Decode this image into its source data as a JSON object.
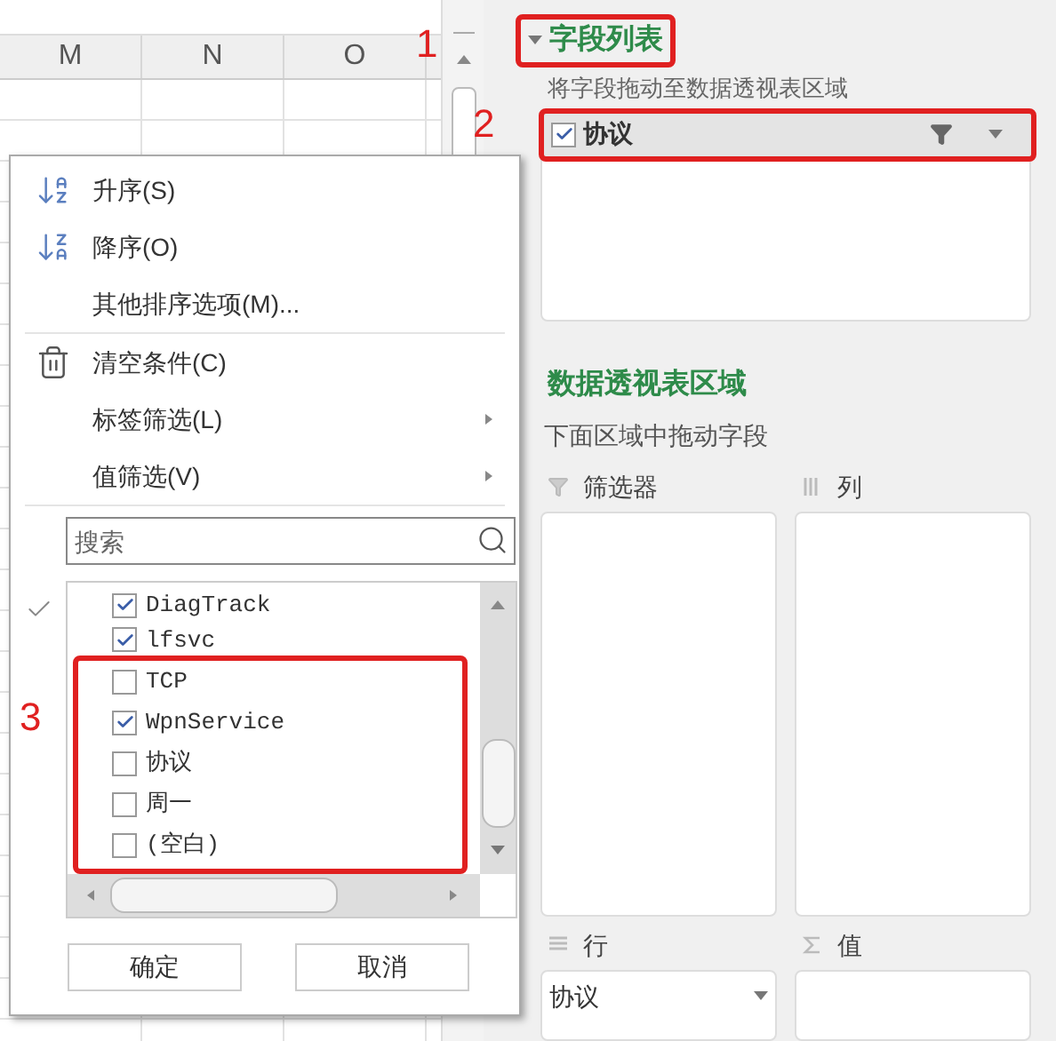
{
  "sheet": {
    "columns": [
      "M",
      "N",
      "O"
    ]
  },
  "panel": {
    "title": "字段列表",
    "hint": "将字段拖动至数据透视表区域",
    "fields": [
      {
        "label": "协议",
        "checked": true
      }
    ],
    "areas_title": "数据透视表区域",
    "areas_hint": "下面区域中拖动字段",
    "areas": [
      {
        "kind": "filter",
        "label": "筛选器"
      },
      {
        "kind": "columns",
        "label": "列"
      },
      {
        "kind": "rows",
        "label": "行",
        "items": [
          "协议"
        ]
      },
      {
        "kind": "values",
        "label": "值"
      }
    ]
  },
  "popup": {
    "menu_groups": [
      [
        {
          "kind": "sort_asc",
          "label": "升序(S)"
        },
        {
          "kind": "sort_desc",
          "label": "降序(O)"
        },
        {
          "kind": "plain",
          "label": "其他排序选项(M)..."
        }
      ],
      [
        {
          "kind": "clear",
          "label": "清空条件(C)"
        },
        {
          "kind": "submenu",
          "label": "标签筛选(L)"
        },
        {
          "kind": "submenu",
          "label": "值筛选(V)"
        }
      ]
    ],
    "search": {
      "placeholder": "搜索"
    },
    "items": [
      {
        "label": "DiagTrack",
        "checked": true
      },
      {
        "label": "lfsvc",
        "checked": true
      },
      {
        "label": "TCP",
        "checked": false
      },
      {
        "label": "WpnService",
        "checked": true
      },
      {
        "label": "协议",
        "checked": false
      },
      {
        "label": "周一",
        "checked": false
      },
      {
        "label": "(空白)",
        "checked": false
      }
    ],
    "buttons": [
      "确定",
      "取消"
    ]
  },
  "annotations": [
    "1",
    "2",
    "3"
  ]
}
